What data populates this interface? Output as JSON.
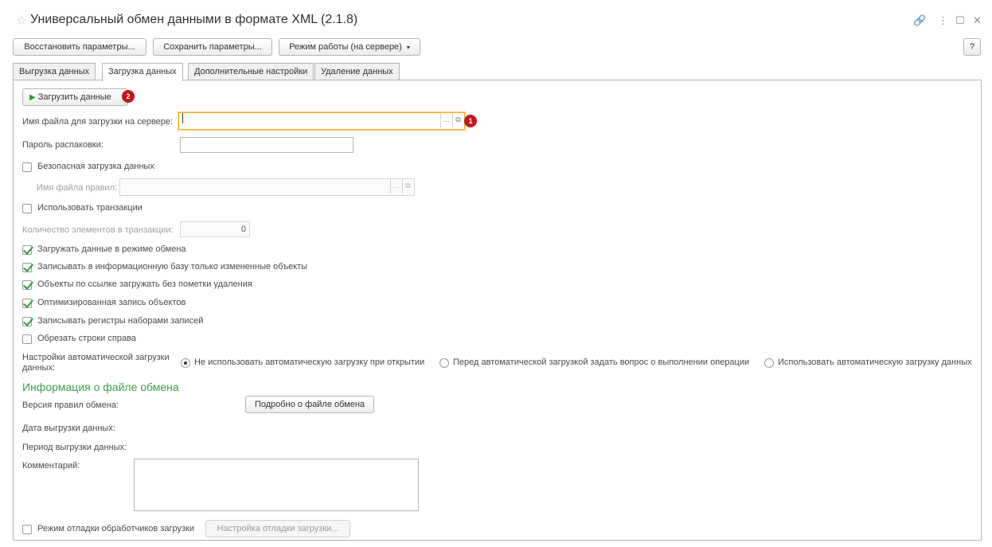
{
  "window": {
    "title": "Универсальный обмен данными в формате XML (2.1.8)",
    "icons": {
      "star": "star-icon",
      "link": "link-icon",
      "more": "more-icon",
      "maximize": "maximize-icon",
      "close": "close-icon"
    }
  },
  "toolbar": {
    "restore_label": "Восстановить параметры...",
    "save_label": "Сохранить параметры...",
    "mode_label": "Режим работы (на сервере)",
    "help_label": "?"
  },
  "tabs": [
    {
      "label": "Выгрузка данных"
    },
    {
      "label": "Загрузка данных"
    },
    {
      "label": "Дополнительные настройки"
    },
    {
      "label": "Удаление данных"
    }
  ],
  "load_button": {
    "label": "Загрузить данные",
    "badge": "2"
  },
  "file_field": {
    "label": "Имя файла для загрузки на сервере:",
    "value": "",
    "badge": "1"
  },
  "password": {
    "label": "Пароль распаковки:",
    "value": ""
  },
  "safe_load": {
    "label": "Безопасная загрузка данных",
    "checked": false
  },
  "rules_file": {
    "label": "Имя файла правил:",
    "value": ""
  },
  "use_transactions": {
    "label": "Использовать транзакции",
    "checked": false
  },
  "tx_count": {
    "label": "Количество элементов в транзакции:",
    "value": "0"
  },
  "options": [
    {
      "label": "Загружать данные в режиме обмена",
      "checked": true
    },
    {
      "label": "Записывать в информационную базу только измененные объекты",
      "checked": true
    },
    {
      "label": "Объекты по ссылке загружать без пометки удаления",
      "checked": true
    },
    {
      "label": "Оптимизированная запись объектов",
      "checked": true
    },
    {
      "label": "Записывать регистры наборами записей",
      "checked": true
    },
    {
      "label": "Обрезать строки справа",
      "checked": false
    }
  ],
  "auto_load": {
    "label_line1": "Настройки автоматической загрузки",
    "label_line2": "данных:",
    "choices": [
      {
        "label": "Не использовать автоматическую загрузку при открытии",
        "selected": true
      },
      {
        "label": "Перед автоматической загрузкой задать вопрос о выполнении операции",
        "selected": false
      },
      {
        "label": "Использовать автоматическую загрузку данных",
        "selected": false
      }
    ]
  },
  "info": {
    "heading": "Информация о файле обмена",
    "rules_version_label": "Версия правил обмена:",
    "details_button": "Подробно о файле обмена",
    "export_date_label": "Дата выгрузки данных:",
    "export_period_label": "Период выгрузки данных:",
    "comment_label": "Комментарий:",
    "comment_value": ""
  },
  "debug": {
    "label": "Режим отладки обработчиков загрузки",
    "checked": false,
    "settings_button": "Настройка отладки загрузки..."
  },
  "colors": {
    "accent_green": "#3aa04a",
    "badge_red": "#c0171c",
    "focus_yellow": "#f2b01e"
  }
}
